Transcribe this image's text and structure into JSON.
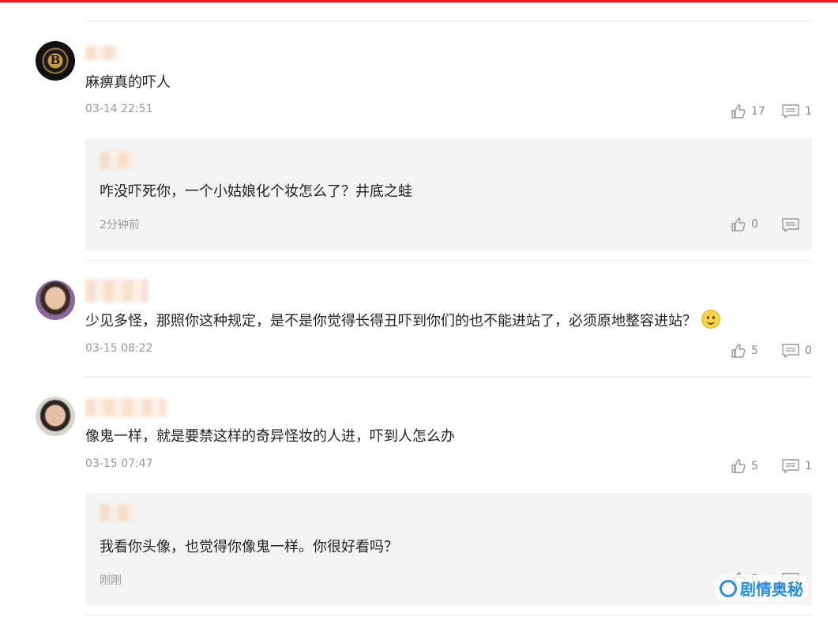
{
  "comments": [
    {
      "text": "麻痹真的吓人",
      "time": "03-14 22:51",
      "likes": "17",
      "replies": "1",
      "reply": {
        "text": "咋没吓死你，一个小姑娘化个妆怎么了？井底之蛙",
        "time": "2分钟前",
        "likes": "0",
        "replies": ""
      }
    },
    {
      "text": "少见多怪，那照你这种规定，是不是你觉得长得丑吓到你们的也不能进站了，必须原地整容进站？",
      "time": "03-15 08:22",
      "likes": "5",
      "replies": "0"
    },
    {
      "text": "像鬼一样，就是要禁这样的奇异怪妆的人进，吓到人怎么办",
      "time": "03-15 07:47",
      "likes": "5",
      "replies": "1",
      "reply": {
        "text": "我看你头像，也觉得你像鬼一样。你很好看吗？",
        "time": "刚刚",
        "likes": "0",
        "replies": ""
      }
    }
  ],
  "watermark": "剧情奥秘",
  "icons": {
    "like": "thumbs-up-icon",
    "reply": "comment-icon",
    "emoji": "smile-emoji-icon"
  },
  "colors": {
    "topbar": "#e02020",
    "reply_bg": "#f4f4f4",
    "meta": "#999999",
    "watermark": "#2a8de0"
  }
}
